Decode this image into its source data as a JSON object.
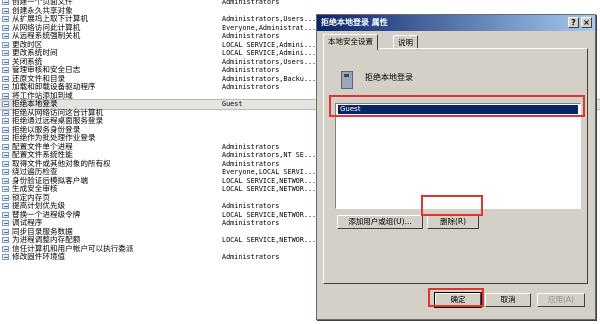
{
  "policies": [
    {
      "name": "创建一个页面文件",
      "setting": "Administrators"
    },
    {
      "name": "创建永久共享对象",
      "setting": ""
    },
    {
      "name": "从扩展坞上取下计算机",
      "setting": "Administrators,Users..."
    },
    {
      "name": "从网络访问此计算机",
      "setting": "Everyone,Administrat..."
    },
    {
      "name": "从远程系统强制关机",
      "setting": "Administrators"
    },
    {
      "name": "更改时区",
      "setting": "LOCAL SERVICE,Admini..."
    },
    {
      "name": "更改系统时间",
      "setting": "LOCAL SERVICE,Admini..."
    },
    {
      "name": "关闭系统",
      "setting": "Administrators,Users..."
    },
    {
      "name": "管理审核和安全日志",
      "setting": "Administrators"
    },
    {
      "name": "还原文件和目录",
      "setting": "Administrators,Backu..."
    },
    {
      "name": "加载和卸载设备驱动程序",
      "setting": "Administrators"
    },
    {
      "name": "将工作站添加到域",
      "setting": ""
    },
    {
      "name": "拒绝本地登录",
      "setting": "Guest"
    },
    {
      "name": "拒绝从网络访问这台计算机",
      "setting": ""
    },
    {
      "name": "拒绝通过远程桌面服务登录",
      "setting": ""
    },
    {
      "name": "拒绝以服务身份登录",
      "setting": ""
    },
    {
      "name": "拒绝作为批处理作业登录",
      "setting": ""
    },
    {
      "name": "配置文件单个进程",
      "setting": "Administrators"
    },
    {
      "name": "配置文件系统性能",
      "setting": "Administrators,NT SE..."
    },
    {
      "name": "取得文件或其他对象的所有权",
      "setting": "Administrators"
    },
    {
      "name": "绕过遍历检查",
      "setting": "Everyone,LOCAL SERVI..."
    },
    {
      "name": "身份验证后模拟客户端",
      "setting": "LOCAL SERVICE,NETWOR..."
    },
    {
      "name": "生成安全审核",
      "setting": "LOCAL SERVICE,NETWOR..."
    },
    {
      "name": "锁定内存页",
      "setting": ""
    },
    {
      "name": "提高计划优先级",
      "setting": "Administrators"
    },
    {
      "name": "替换一个进程级令牌",
      "setting": "LOCAL SERVICE,NETWOR..."
    },
    {
      "name": "调试程序",
      "setting": "Administrators"
    },
    {
      "name": "同步目录服务数据",
      "setting": ""
    },
    {
      "name": "为进程调整内存配额",
      "setting": "LOCAL SERVICE,NETWOR..."
    },
    {
      "name": "信任计算机和用户帐户可以执行委派",
      "setting": ""
    },
    {
      "name": "修改固件环境值",
      "setting": "Administrators"
    }
  ],
  "selected_policy_index": 12,
  "dialog": {
    "title": "拒绝本地登录 属性",
    "help_label": "?",
    "close_label": "×",
    "tabs": {
      "local": "本地安全设置",
      "explain": "说明"
    },
    "policy_name": "拒绝本地登录",
    "users": [
      "Guest"
    ],
    "add_label": "添加用户或组(U)...",
    "remove_label": "删除(R)",
    "ok_label": "确定",
    "cancel_label": "取消",
    "apply_label": "应用(A)"
  },
  "colors": {
    "highlight": "#e0342f",
    "selection": "#0a246a"
  }
}
